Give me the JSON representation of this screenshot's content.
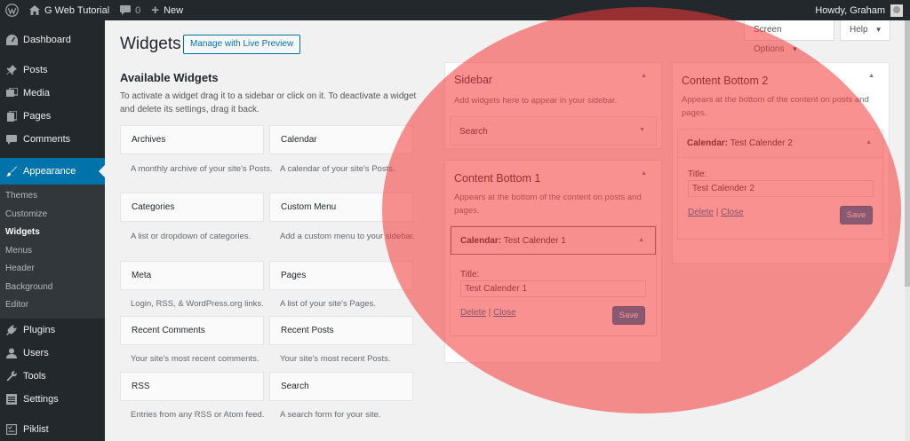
{
  "adminbar": {
    "site_name": "G Web Tutorial",
    "comments_count": "0",
    "new_label": "New",
    "howdy": "Howdy, Graham"
  },
  "menu": {
    "dashboard": "Dashboard",
    "posts": "Posts",
    "media": "Media",
    "pages": "Pages",
    "comments": "Comments",
    "appearance": "Appearance",
    "sub": [
      "Themes",
      "Customize",
      "Widgets",
      "Menus",
      "Header",
      "Background",
      "Editor"
    ],
    "plugins": "Plugins",
    "users": "Users",
    "tools": "Tools",
    "settings": "Settings",
    "piklist": "Piklist"
  },
  "header": {
    "title": "Widgets",
    "live_preview": "Manage with Live Preview",
    "screen_options": "Screen Options",
    "help": "Help"
  },
  "available": {
    "title": "Available Widgets",
    "description": "To activate a widget drag it to a sidebar or click on it. To deactivate a widget and delete its settings, drag it back.",
    "widgets": [
      {
        "name": "Archives",
        "desc": "A monthly archive of your site's Posts."
      },
      {
        "name": "Calendar",
        "desc": "A calendar of your site's Posts."
      },
      {
        "name": "Categories",
        "desc": "A list or dropdown of categories."
      },
      {
        "name": "Custom Menu",
        "desc": "Add a custom menu to your sidebar."
      },
      {
        "name": "Meta",
        "desc": "Login, RSS, & WordPress.org links."
      },
      {
        "name": "Pages",
        "desc": "A list of your site's Pages."
      },
      {
        "name": "Recent Comments",
        "desc": "Your site's most recent comments."
      },
      {
        "name": "Recent Posts",
        "desc": "Your site's most recent Posts."
      },
      {
        "name": "RSS",
        "desc": "Entries from any RSS or Atom feed."
      },
      {
        "name": "Search",
        "desc": "A search form for your site."
      }
    ]
  },
  "sidebar": {
    "title": "Sidebar",
    "desc": "Add widgets here to appear in your sidebar.",
    "widget": "Search"
  },
  "content_bottom_1": {
    "title": "Content Bottom 1",
    "desc": "Appears at the bottom of the content on posts and pages.",
    "widget_type": "Calendar:",
    "widget_name": "Test Calender 1",
    "title_label": "Title:",
    "title_value": "Test Calender 1",
    "delete": "Delete",
    "separator": "|",
    "close": "Close",
    "save": "Save"
  },
  "content_bottom_2": {
    "title": "Content Bottom 2",
    "desc": "Appears at the bottom of the content on posts and pages.",
    "widget_type": "Calendar:",
    "widget_name": "Test Calender 2",
    "title_label": "Title:",
    "title_value": "Test Calender 2",
    "delete": "Delete",
    "separator": "|",
    "close": "Close",
    "save": "Save"
  },
  "icons": {
    "arrow_up": "▲",
    "arrow_down": "▼"
  }
}
